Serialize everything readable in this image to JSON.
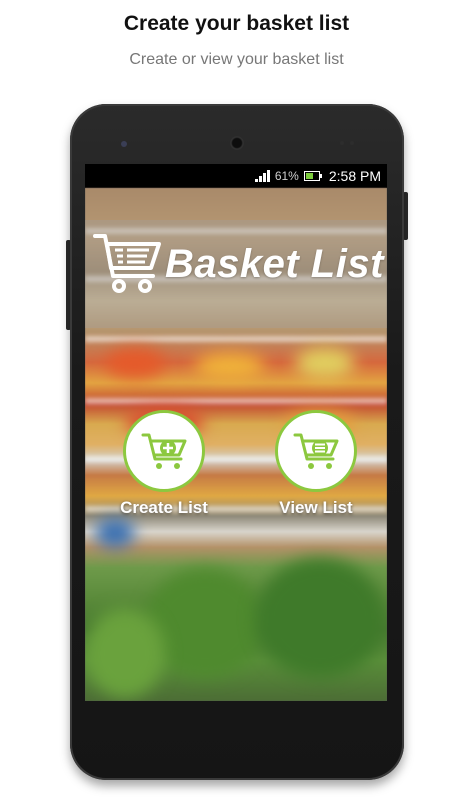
{
  "header": {
    "title": "Create your basket list",
    "subtitle": "Create or view your basket list"
  },
  "status_bar": {
    "battery_percent": "61%",
    "battery_level": 0.61,
    "time": "2:58 PM",
    "icons": [
      "signal-icon",
      "battery-icon"
    ]
  },
  "app": {
    "title": "Basket List",
    "logo_icon": "shopping-cart-checklist-icon",
    "actions": [
      {
        "label": "Create List",
        "icon": "cart-add-icon"
      },
      {
        "label": "View List",
        "icon": "cart-list-icon"
      }
    ]
  },
  "colors": {
    "accent": "#8cc83f",
    "text_dark": "#111111",
    "text_muted": "#777777"
  }
}
